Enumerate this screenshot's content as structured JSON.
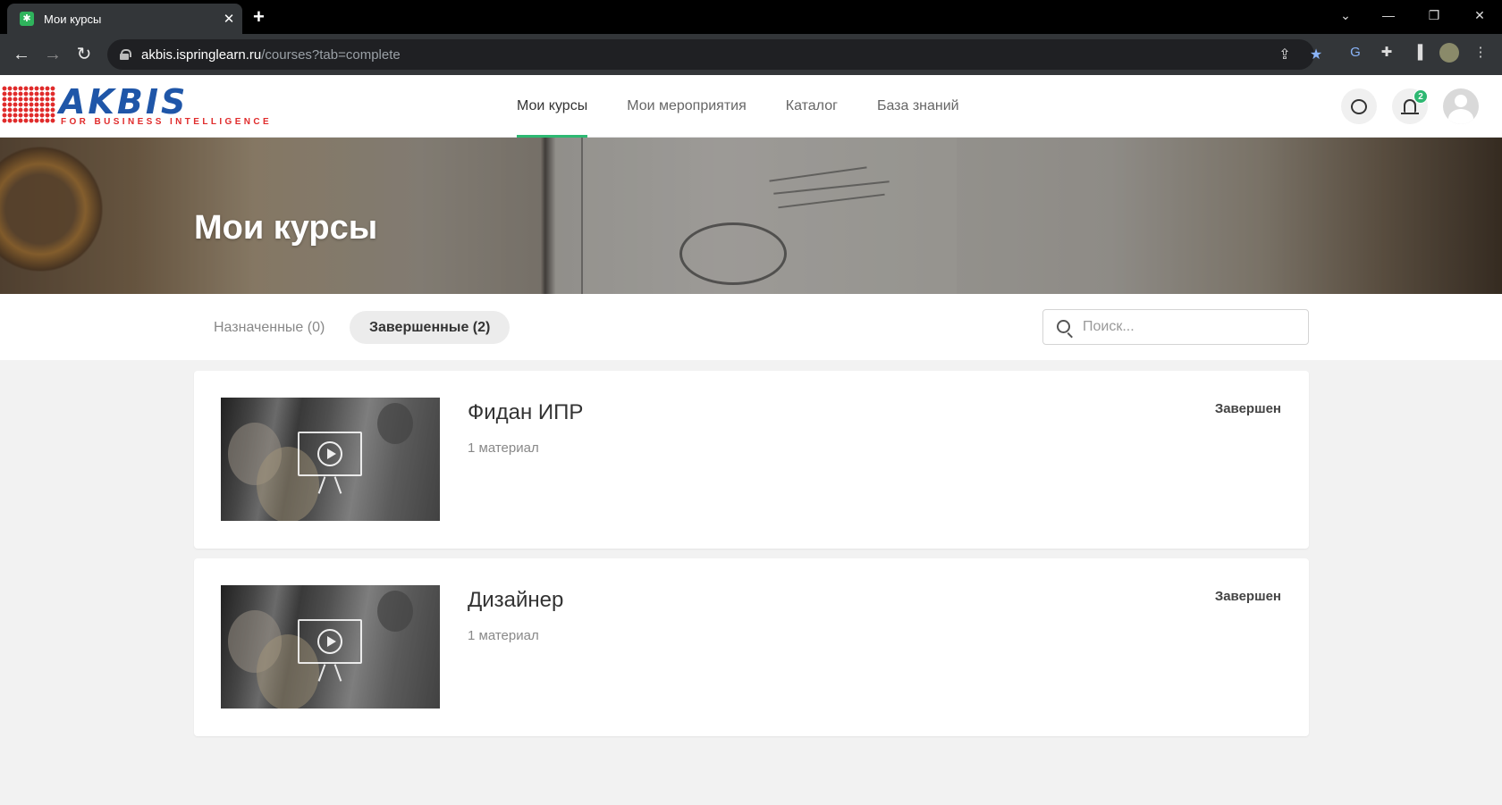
{
  "browser": {
    "tab_title": "Мои курсы",
    "url_host": "akbis.ispringlearn.ru",
    "url_path": "/courses?tab=complete"
  },
  "logo": {
    "name": "AKBIS",
    "tagline": "FOR BUSINESS INTELLIGENCE"
  },
  "nav": {
    "items": [
      {
        "label": "Мои курсы",
        "active": true
      },
      {
        "label": "Мои мероприятия",
        "active": false
      },
      {
        "label": "Каталог",
        "active": false
      },
      {
        "label": "База знаний",
        "active": false
      }
    ]
  },
  "header": {
    "notification_count": "2"
  },
  "hero": {
    "title": "Мои курсы"
  },
  "filters": {
    "tabs": [
      {
        "label": "Назначенные (0)",
        "active": false
      },
      {
        "label": "Завершенные (2)",
        "active": true
      }
    ],
    "search_placeholder": "Поиск..."
  },
  "courses": [
    {
      "title": "Фидан ИПР",
      "materials": "1 материал",
      "status": "Завершен"
    },
    {
      "title": "Дизайнер",
      "materials": "1 материал",
      "status": "Завершен"
    }
  ],
  "colors": {
    "accent": "#2eb872",
    "logo_blue": "#1f56a8",
    "logo_red": "#e02b2b"
  }
}
